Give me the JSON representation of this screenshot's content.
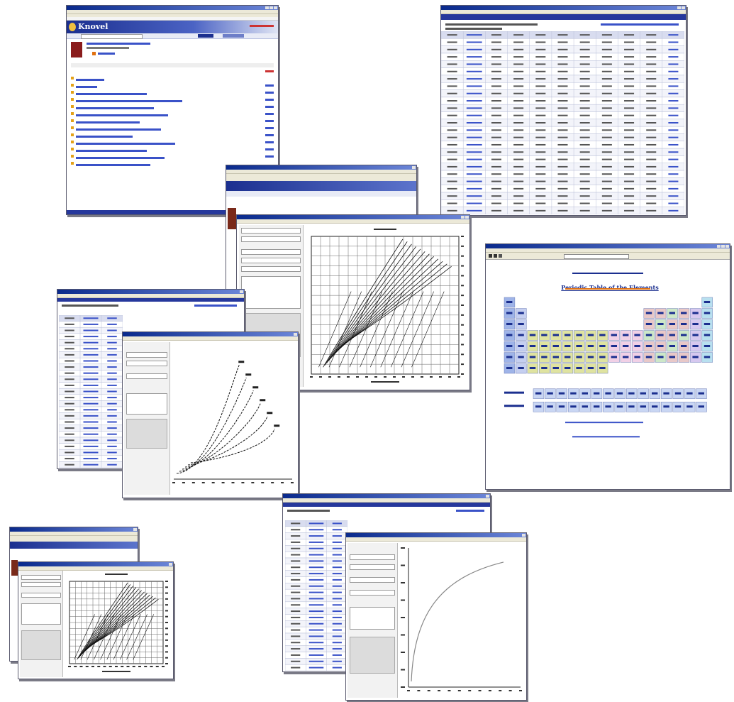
{
  "knovel": {
    "logo": "Knovel"
  },
  "periodic": {
    "title": "Periodic Table of the Elements"
  },
  "icons": {
    "knovel_logo": "knovel-logo-icon",
    "book_cover": "book-cover-icon"
  },
  "colors": {
    "title_bar": "#1b2f8f",
    "link": "#3a52c8",
    "bullet": "#e4a21a",
    "plot_line": "#111111",
    "curve_gray": "#888888"
  }
}
